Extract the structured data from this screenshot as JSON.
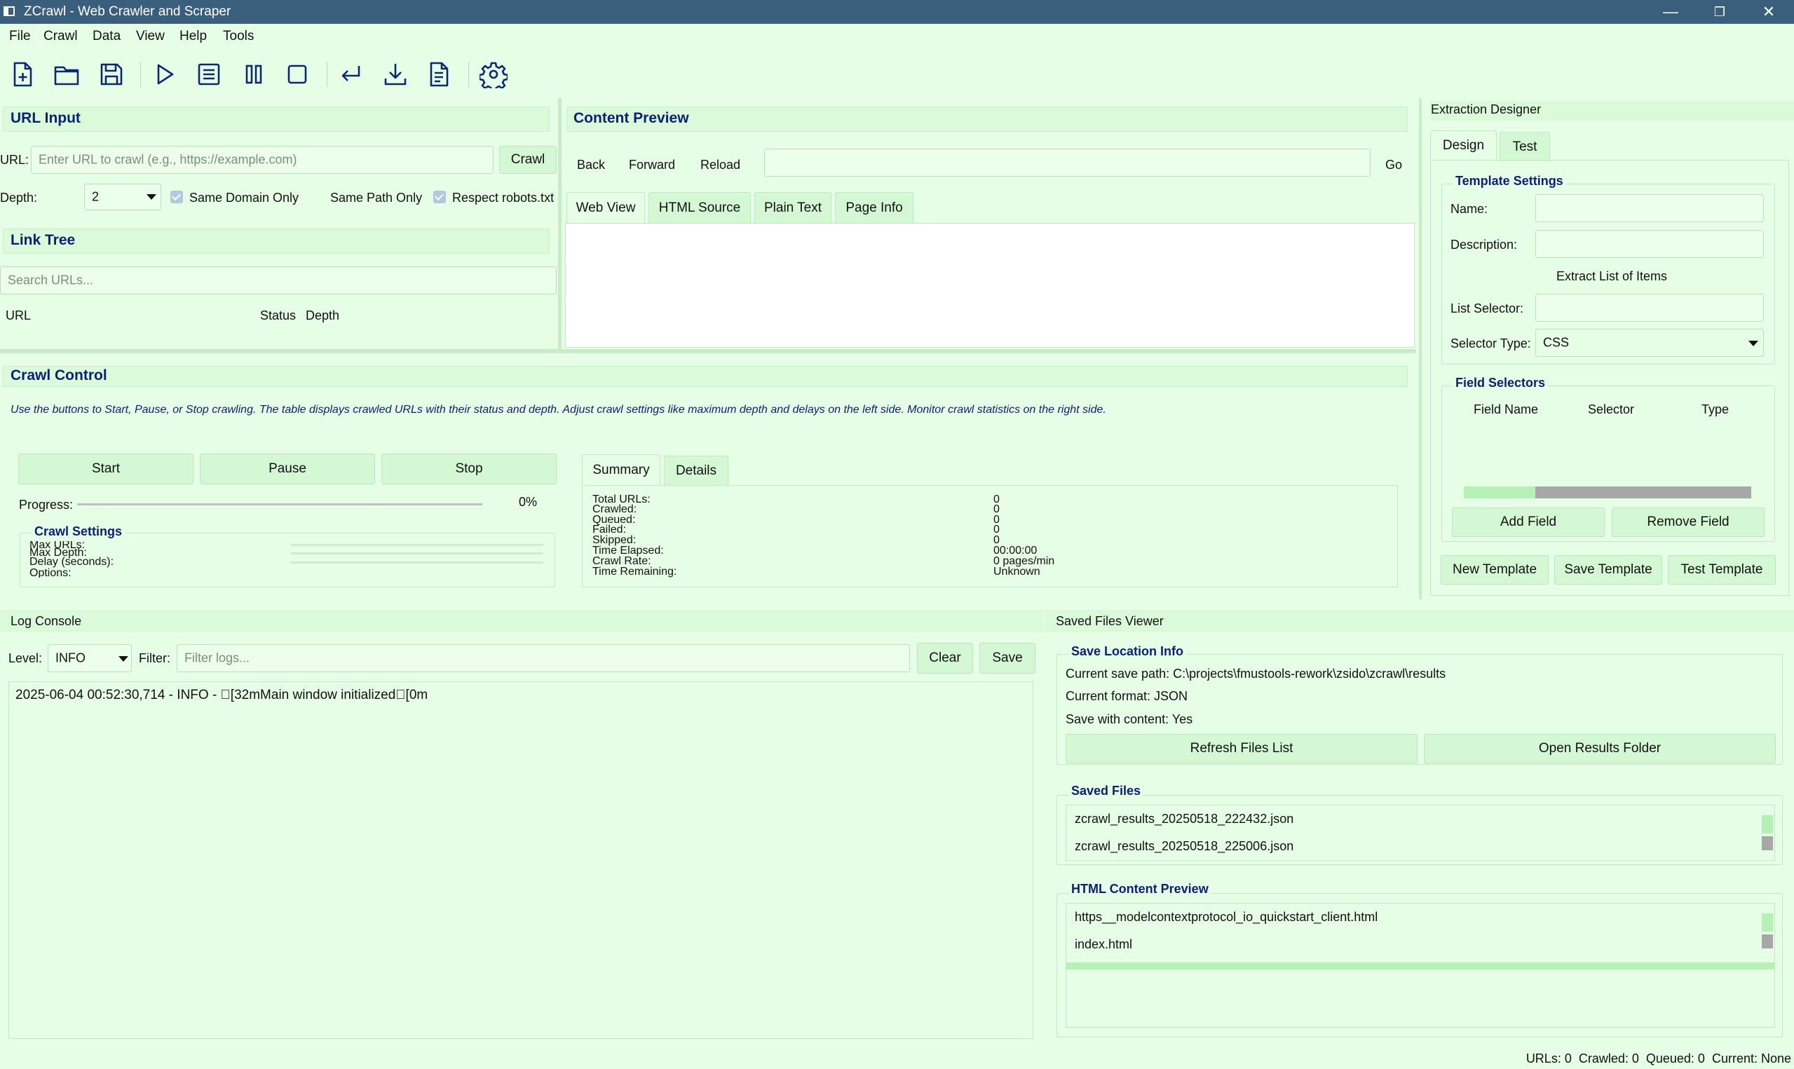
{
  "window": {
    "title": "ZCrawl - Web Crawler and Scraper",
    "controls": [
      "—",
      "❐",
      "✕"
    ]
  },
  "menu": [
    "File",
    "Crawl",
    "Data",
    "View",
    "Help",
    "Tools"
  ],
  "toolbar_icons": [
    "new-file-icon",
    "open-folder-icon",
    "save-icon",
    "play-icon",
    "list-icon",
    "pause-icon",
    "stop-icon",
    "return-icon",
    "download-icon",
    "document-icon",
    "settings-icon"
  ],
  "url_input": {
    "title": "URL Input",
    "url_label": "URL:",
    "url_placeholder": "Enter URL to crawl (e.g., https://example.com)",
    "crawl_button": "Crawl",
    "depth_label": "Depth:",
    "depth_value": "2",
    "same_domain": "Same Domain Only",
    "same_domain_checked": true,
    "same_path": "Same Path Only",
    "same_path_checked": false,
    "respect_robots": "Respect robots.txt",
    "respect_robots_checked": true
  },
  "link_tree": {
    "title": "Link Tree",
    "search_placeholder": "Search URLs...",
    "columns": [
      "URL",
      "Status",
      "Depth"
    ]
  },
  "content_preview": {
    "title": "Content Preview",
    "back": "Back",
    "forward": "Forward",
    "reload": "Reload",
    "address": "",
    "go": "Go",
    "tabs": [
      "Web View",
      "HTML Source",
      "Plain Text",
      "Page Info"
    ],
    "active_tab": 0
  },
  "extraction": {
    "title": "Extraction Designer",
    "tabs": [
      "Design",
      "Test"
    ],
    "template_settings": "Template Settings",
    "name_label": "Name:",
    "description_label": "Description:",
    "extract_list": "Extract List of Items",
    "list_selector_label": "List Selector:",
    "selector_type_label": "Selector Type:",
    "selector_type_value": "CSS",
    "field_selectors": "Field Selectors",
    "field_columns": [
      "Field Name",
      "Selector",
      "Type"
    ],
    "add_field": "Add Field",
    "remove_field": "Remove Field",
    "new_template": "New Template",
    "save_template": "Save Template",
    "test_template": "Test Template"
  },
  "crawl_control": {
    "title": "Crawl Control",
    "help": "Use the buttons to Start, Pause, or Stop crawling. The table displays crawled URLs with their status and depth. Adjust crawl settings like maximum depth and delays on the left side. Monitor crawl statistics on the right side.",
    "start": "Start",
    "pause": "Pause",
    "stop": "Stop",
    "progress_label": "Progress:",
    "progress_text": "0%",
    "progress_fraction": 0,
    "crawl_settings": "Crawl Settings",
    "settings_rows": [
      "Max URLs:",
      "Max Depth:",
      "Delay (seconds):",
      "Options:"
    ],
    "stats_tabs": [
      "Summary",
      "Details"
    ],
    "stats": [
      {
        "label": "Total URLs:",
        "value": "0"
      },
      {
        "label": "Crawled:",
        "value": "0"
      },
      {
        "label": "Queued:",
        "value": "0"
      },
      {
        "label": "Failed:",
        "value": "0"
      },
      {
        "label": "Skipped:",
        "value": "0"
      },
      {
        "label": "Time Elapsed:",
        "value": "00:00:00"
      },
      {
        "label": "Crawl Rate:",
        "value": "0 pages/min"
      },
      {
        "label": "Time Remaining:",
        "value": "Unknown"
      }
    ]
  },
  "log_console": {
    "title": "Log Console",
    "level_label": "Level:",
    "level_value": "INFO",
    "filter_label": "Filter:",
    "filter_placeholder": "Filter logs...",
    "clear": "Clear",
    "save": "Save",
    "lines": [
      "2025-06-04 00:52:30,714 - INFO - \u0000[32mMain window initialized\u0000[0m"
    ]
  },
  "saved_files": {
    "title": "Saved Files Viewer",
    "location_title": "Save Location Info",
    "save_path": "Current save path: C:\\projects\\fmustools-rework\\zsido\\zcrawl\\results",
    "format": "Current format: JSON",
    "with_content": "Save with content: Yes",
    "refresh": "Refresh Files List",
    "open_folder": "Open Results Folder",
    "files_title": "Saved Files",
    "files": [
      "zcrawl_results_20250518_222432.json",
      "zcrawl_results_20250518_225006.json"
    ],
    "html_title": "HTML Content Preview",
    "html_files": [
      "https__modelcontextprotocol_io_quickstart_client.html",
      "index.html"
    ]
  },
  "status_bar": "URLs: 0  Crawled: 0  Queued: 0  Current: None",
  "colors": {
    "background": "#e6fde6",
    "titlebar": "#3a5f7c",
    "section_title": "#0b1f75"
  }
}
